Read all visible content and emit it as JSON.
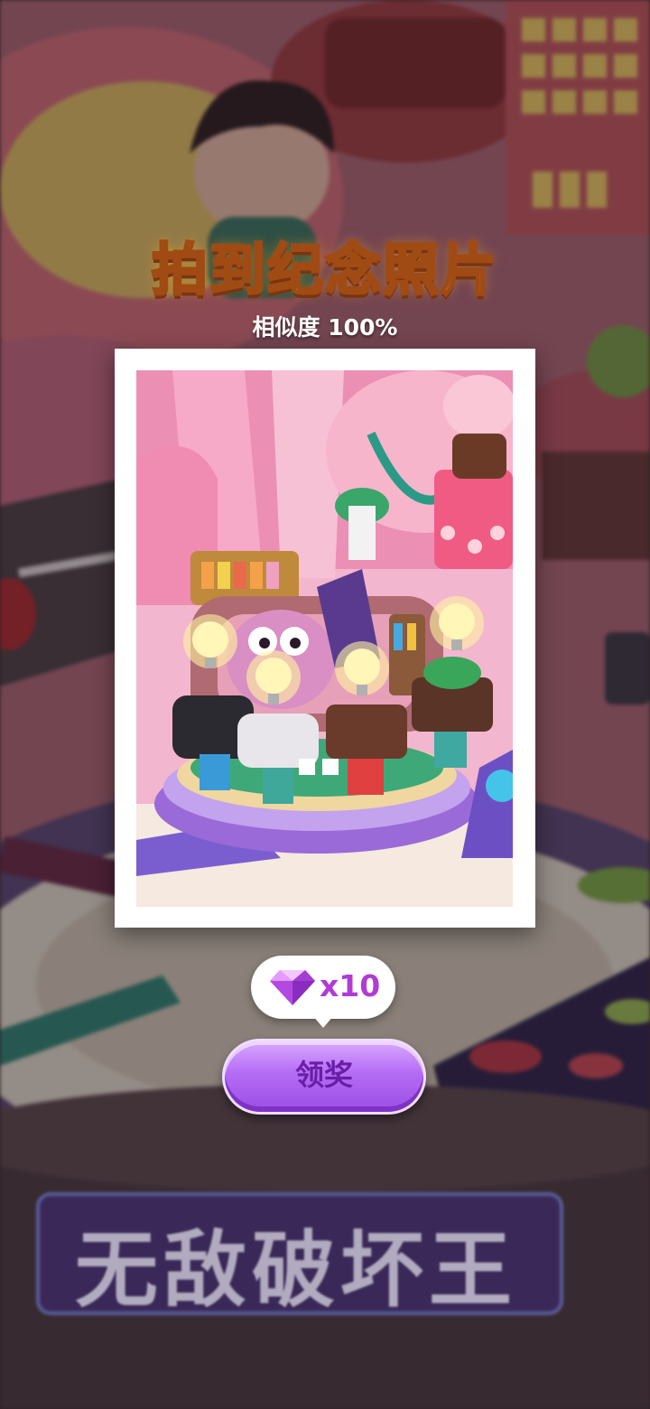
{
  "popup": {
    "title": "拍到纪念照片",
    "similarity": "相似度 100%"
  },
  "reward": {
    "icon": "purple-gem-icon",
    "quantity": "x10"
  },
  "claim_button": {
    "label": "领奖"
  },
  "background": {
    "sign_text": "无敌破坏王"
  },
  "colors": {
    "title": "#ffd94a",
    "button": "#b46cf4",
    "gem": "#c05ae8"
  }
}
